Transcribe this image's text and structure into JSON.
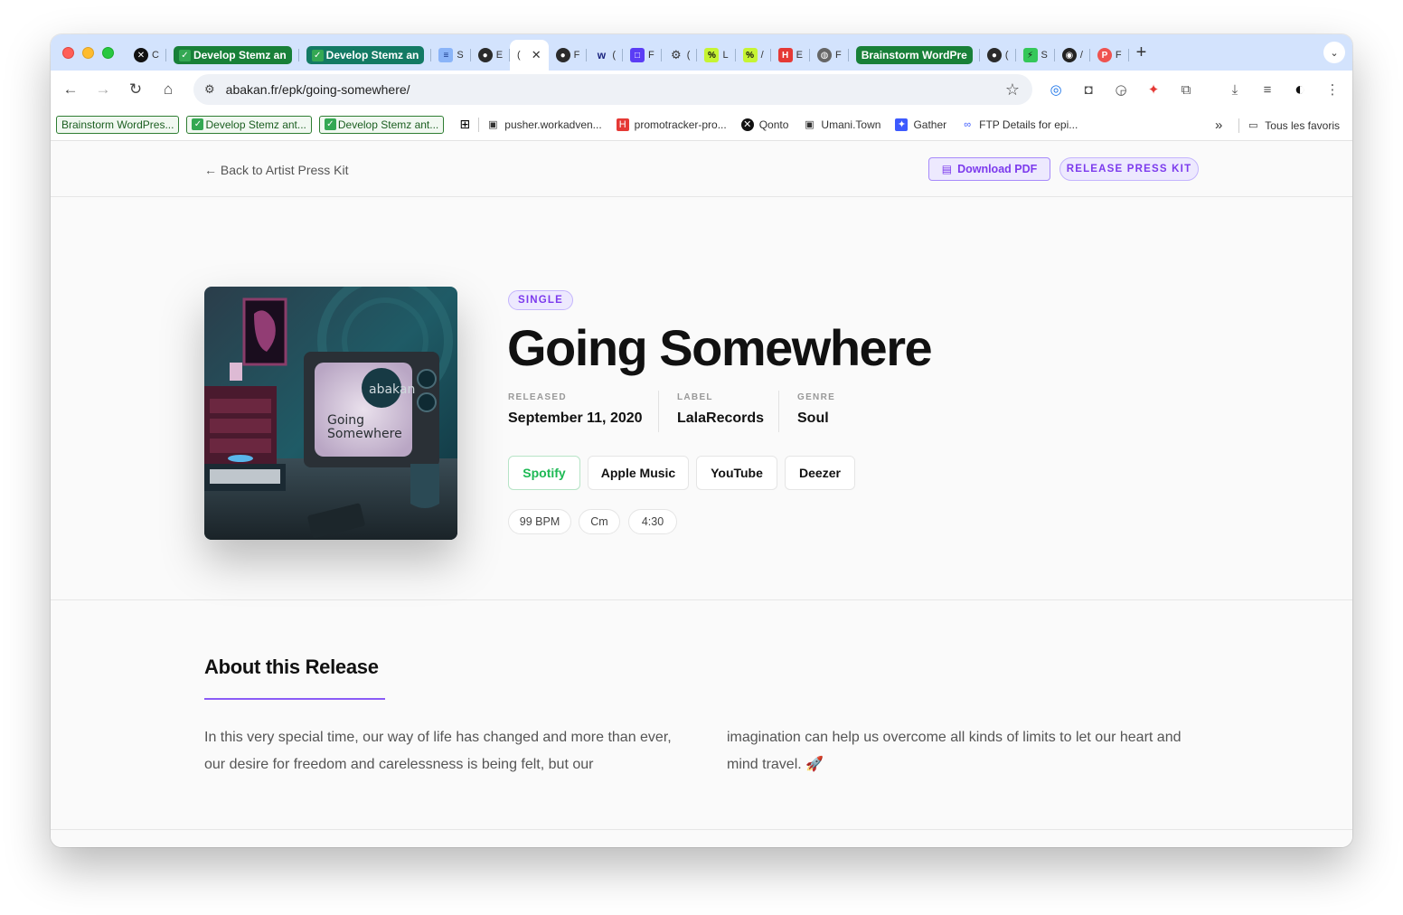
{
  "browser": {
    "tabs": [
      {
        "label": "C",
        "icon": "x-icon"
      },
      {
        "label": "Develop Stemz an",
        "group": "green"
      },
      {
        "label": "Develop Stemz an",
        "group": "teal"
      },
      {
        "label": "S",
        "icon": "stack-icon"
      },
      {
        "label": "E",
        "icon": "record-icon"
      },
      {
        "label": "(",
        "icon": "loading-icon",
        "active": true
      },
      {
        "label": "F",
        "icon": "record-icon"
      },
      {
        "label": "(",
        "icon": "wave-icon"
      },
      {
        "label": "F",
        "icon": "square-icon"
      },
      {
        "label": "(",
        "icon": "openai-icon"
      },
      {
        "label": "L",
        "icon": "lime-icon"
      },
      {
        "label": "/",
        "icon": "lime-icon"
      },
      {
        "label": "E",
        "icon": "h-icon"
      },
      {
        "label": "F",
        "icon": "globe-icon"
      },
      {
        "label": "Brainstorm WordPre",
        "group": "green"
      },
      {
        "label": "(",
        "icon": "record-icon"
      },
      {
        "label": "S",
        "icon": "bolt-icon"
      },
      {
        "label": "/",
        "icon": "github-icon"
      },
      {
        "label": "F",
        "icon": "p-icon"
      }
    ],
    "url": "abakan.fr/epk/going-somewhere/",
    "bookmarks": {
      "chips": [
        "Brainstorm WordPres...",
        "Develop Stemz ant...",
        "Develop Stemz ant..."
      ],
      "items": [
        "pusher.workadven...",
        "promotracker-pro...",
        "Qonto",
        "Umani.Town",
        "Gather",
        "FTP Details for epi..."
      ],
      "more": "»",
      "all_favorites": "Tous les favoris"
    }
  },
  "page": {
    "back_link": "← Back to Artist Press Kit",
    "download_pdf": "Download PDF",
    "release_kit": "RELEASE PRESS KIT",
    "release": {
      "type": "SINGLE",
      "title": "Going Somewhere",
      "cover_text_1": "Going",
      "cover_text_2": "Somewhere",
      "cover_logo": "abakan",
      "meta": {
        "released_label": "RELEASED",
        "released": "September 11, 2020",
        "label_label": "LABEL",
        "label": "LalaRecords",
        "genre_label": "GENRE",
        "genre": "Soul"
      },
      "streaming": [
        "Spotify",
        "Apple Music",
        "YouTube",
        "Deezer"
      ],
      "tags": [
        "99 BPM",
        "Cm",
        "4:30"
      ]
    },
    "about": {
      "heading": "About this Release",
      "col1": "In this very special time, our way of life has changed and more than ever, our desire for freedom and carelessness is being felt, but our",
      "col2": "imagination can help us overcome all kinds of limits to let our heart and mind travel. 🚀"
    }
  },
  "colors": {
    "accent": "#7c3aed",
    "accent_light": "#ede9fe",
    "spotify": "#1db954",
    "tab_strip": "#d3e3fd"
  }
}
